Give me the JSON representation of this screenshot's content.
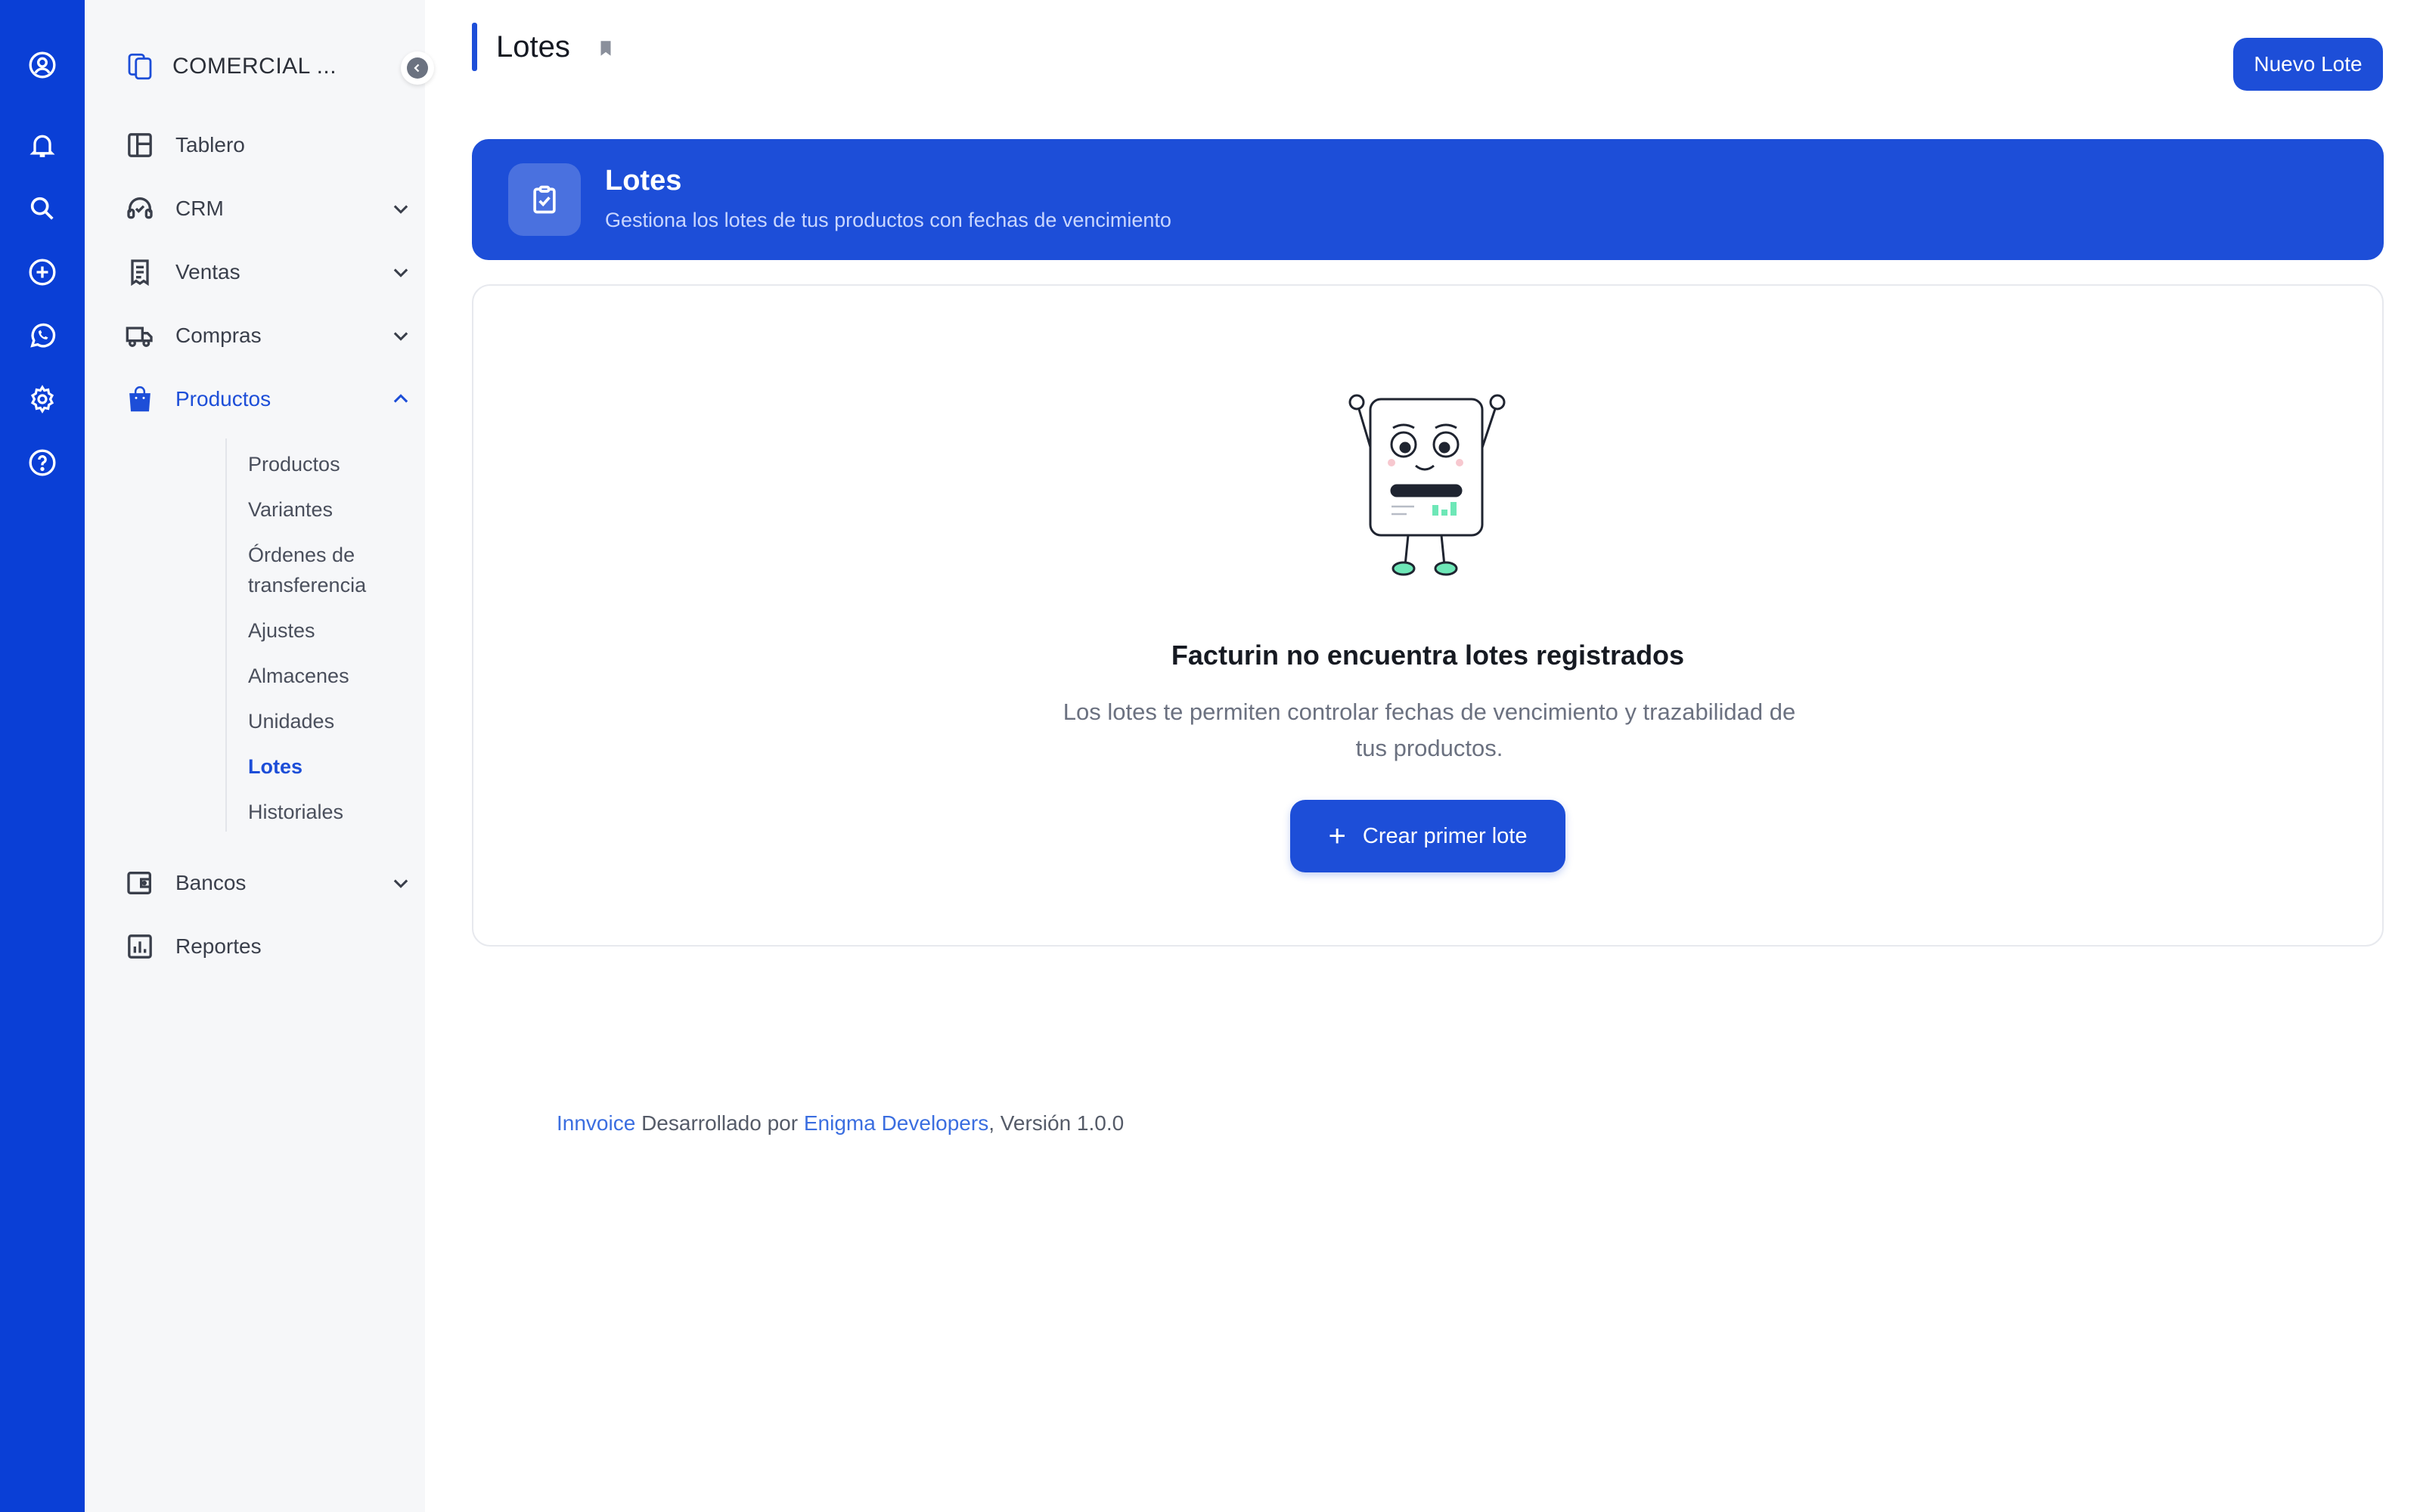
{
  "colors": {
    "rail": "#0a3fd6",
    "primary": "#1d4ed8",
    "sidebar_bg": "#f6f7f9"
  },
  "rail": {
    "items": [
      {
        "name": "user-circle-icon"
      },
      {
        "name": "bell-icon"
      },
      {
        "name": "search-icon"
      },
      {
        "name": "plus-circle-icon"
      },
      {
        "name": "whatsapp-icon"
      },
      {
        "name": "gear-icon"
      },
      {
        "name": "help-icon"
      }
    ]
  },
  "sidebar": {
    "company": "COMERCIAL ...",
    "items": [
      {
        "label": "Tablero",
        "icon": "dashboard-icon"
      },
      {
        "label": "CRM",
        "icon": "headset-icon"
      },
      {
        "label": "Ventas",
        "icon": "receipt-icon"
      },
      {
        "label": "Compras",
        "icon": "truck-icon"
      },
      {
        "label": "Productos",
        "icon": "shopping-bag-icon"
      },
      {
        "label": "Bancos",
        "icon": "wallet-icon"
      },
      {
        "label": "Reportes",
        "icon": "chart-icon"
      }
    ],
    "sub_items": [
      "Productos",
      "Variantes",
      "Órdenes de transferencia",
      "Ajustes",
      "Almacenes",
      "Unidades",
      "Lotes",
      "Historiales"
    ]
  },
  "header": {
    "title": "Lotes",
    "new_button": "Nuevo Lote"
  },
  "banner": {
    "title": "Lotes",
    "subtitle": "Gestiona los lotes de tus productos con fechas de vencimiento"
  },
  "empty": {
    "title": "Facturin no encuentra lotes registrados",
    "description": "Los lotes te permiten controlar fechas de vencimiento y trazabilidad de tus productos.",
    "button": "Crear primer lote",
    "button_icon": "+"
  },
  "footer": {
    "brand": "Innvoice",
    "developed_by": " Desarrollado por ",
    "company": "Enigma Developers",
    "version": ", Versión 1.0.0"
  }
}
